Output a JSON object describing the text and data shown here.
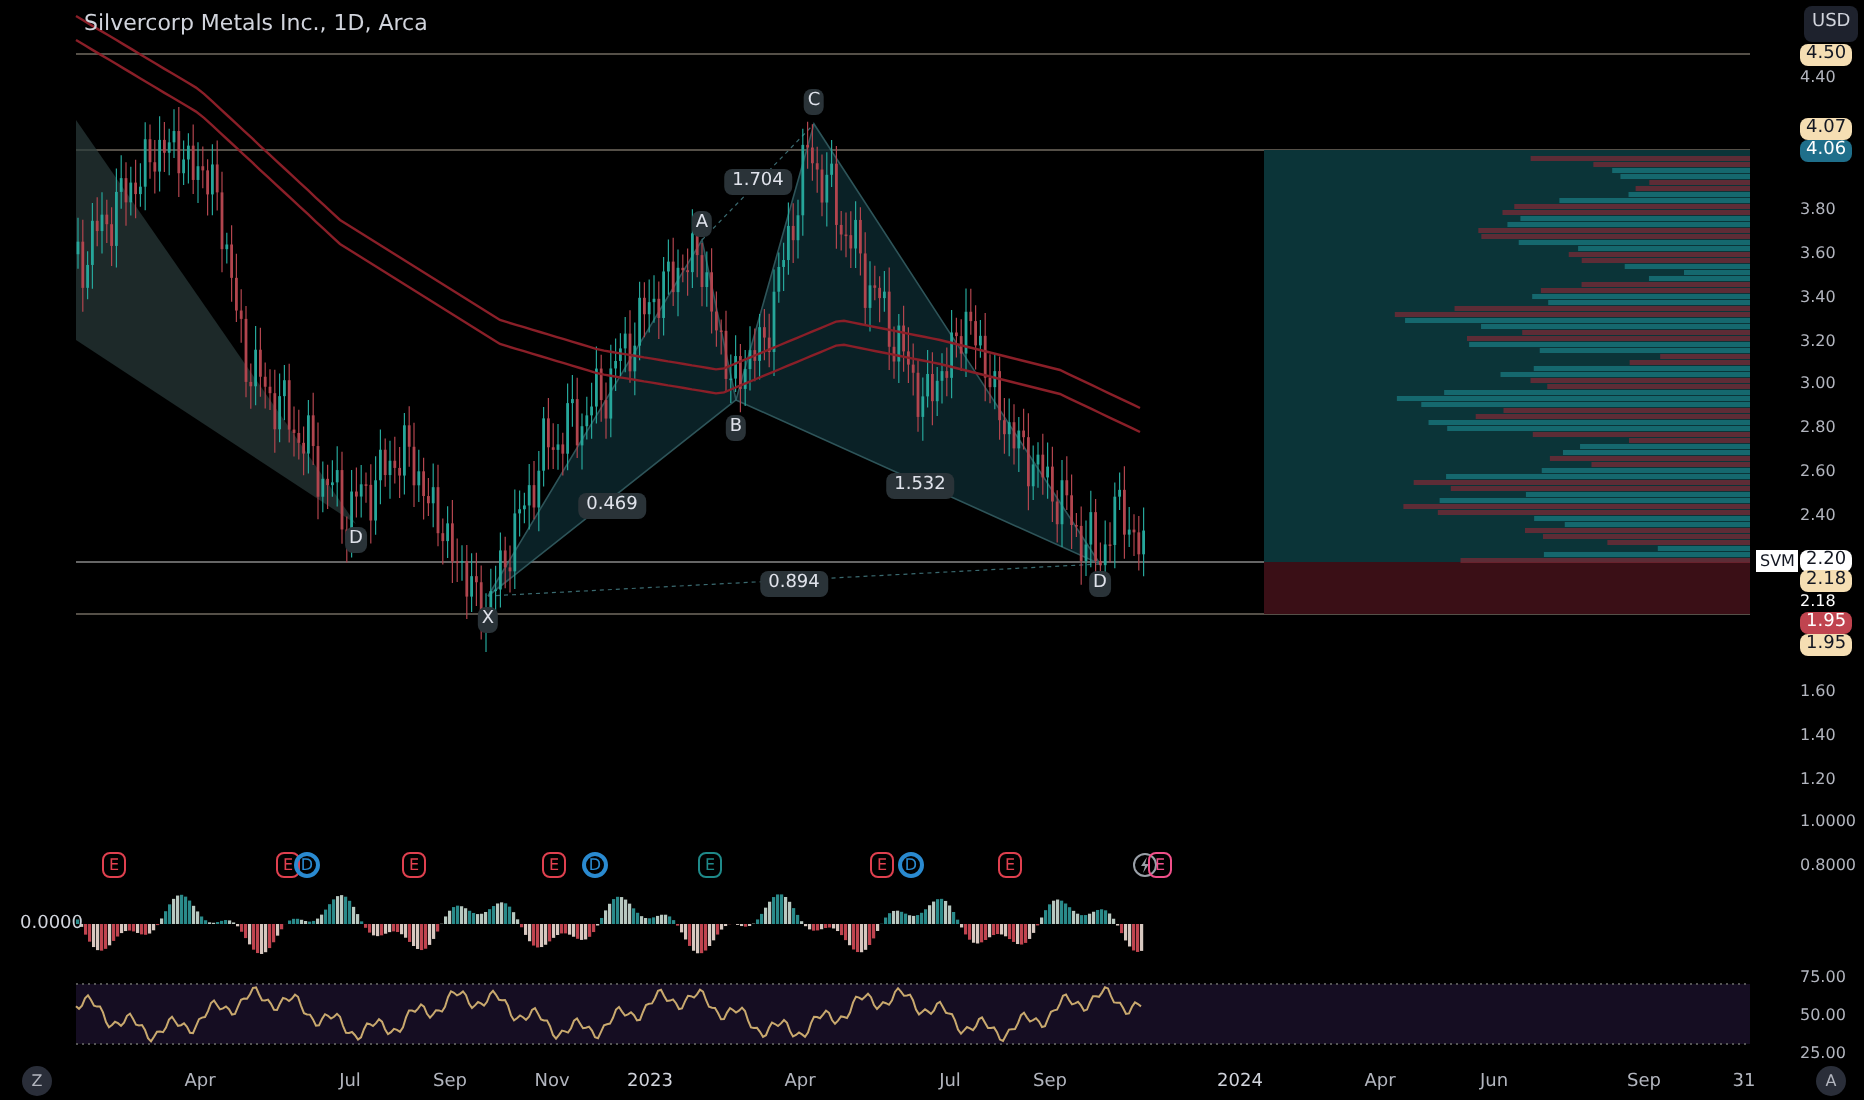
{
  "title": "Silvercorp Metals Inc., 1D, Arca",
  "currency_button": "USD",
  "price_axis": [
    {
      "kind": "badge",
      "text": "4.50",
      "color": "#f5deb3"
    },
    {
      "kind": "plain",
      "text": "4.40"
    },
    {
      "kind": "badge",
      "text": "4.07",
      "color": "#f5deb3"
    },
    {
      "kind": "badge",
      "text": "4.06",
      "color": "#1f6f8b"
    },
    {
      "kind": "plain",
      "text": "3.80"
    },
    {
      "kind": "plain",
      "text": "3.60"
    },
    {
      "kind": "plain",
      "text": "3.40"
    },
    {
      "kind": "plain",
      "text": "3.20"
    },
    {
      "kind": "plain",
      "text": "3.00"
    },
    {
      "kind": "plain",
      "text": "2.80"
    },
    {
      "kind": "plain",
      "text": "2.60"
    },
    {
      "kind": "plain",
      "text": "2.40"
    },
    {
      "kind": "badge",
      "text": "2.20",
      "color": "#ffffff"
    },
    {
      "kind": "badge",
      "text": "2.18",
      "color": "#f5deb3"
    },
    {
      "kind": "plain",
      "text": "2.18"
    },
    {
      "kind": "badge",
      "text": "1.95",
      "color": "#c0444f"
    },
    {
      "kind": "badge",
      "text": "1.95",
      "color": "#f5deb3"
    },
    {
      "kind": "plain",
      "text": "1.60"
    },
    {
      "kind": "plain",
      "text": "1.40"
    },
    {
      "kind": "plain",
      "text": "1.20"
    },
    {
      "kind": "plain",
      "text": "1.0000"
    },
    {
      "kind": "plain",
      "text": "0.8000"
    },
    {
      "kind": "plain",
      "text": "75.00"
    },
    {
      "kind": "plain",
      "text": "50.00"
    },
    {
      "kind": "plain",
      "text": "25.00"
    }
  ],
  "symbol_tag": "SVM",
  "pattern_labels": [
    {
      "kind": "point",
      "text": "C"
    },
    {
      "kind": "ratio",
      "text": "1.704"
    },
    {
      "kind": "point",
      "text": "A"
    },
    {
      "kind": "point",
      "text": "B"
    },
    {
      "kind": "ratio",
      "text": "1.532"
    },
    {
      "kind": "ratio",
      "text": "0.469"
    },
    {
      "kind": "point",
      "text": "D"
    },
    {
      "kind": "ratio",
      "text": "0.894"
    },
    {
      "kind": "point",
      "text": "D"
    },
    {
      "kind": "point",
      "text": "X"
    }
  ],
  "events": [
    {
      "kind": "earnings",
      "text": "E",
      "color": "#e0404f"
    },
    {
      "kind": "earnings",
      "text": "E",
      "color": "#e0404f"
    },
    {
      "kind": "dividend",
      "text": "D",
      "color": "#2a8ad0"
    },
    {
      "kind": "earnings",
      "text": "E",
      "color": "#e0404f"
    },
    {
      "kind": "earnings",
      "text": "E",
      "color": "#e0404f"
    },
    {
      "kind": "dividend",
      "text": "D",
      "color": "#2a8ad0"
    },
    {
      "kind": "earnings",
      "text": "E",
      "color": "#1f8a8a"
    },
    {
      "kind": "earnings",
      "text": "E",
      "color": "#e0404f"
    },
    {
      "kind": "dividend",
      "text": "D",
      "color": "#2a8ad0"
    },
    {
      "kind": "earnings",
      "text": "E",
      "color": "#e0404f"
    },
    {
      "kind": "split",
      "color": "#9aa0a8"
    },
    {
      "kind": "earnings",
      "text": "E",
      "color": "#f0508a"
    }
  ],
  "oscillator_zero": "0.0000",
  "time_axis": [
    "Apr",
    "Jul",
    "Sep",
    "Nov",
    "2023",
    "Apr",
    "Jul",
    "Sep",
    "2024",
    "Apr",
    "Jun",
    "Sep",
    "31"
  ],
  "left_button": "Z",
  "right_button": "A"
}
